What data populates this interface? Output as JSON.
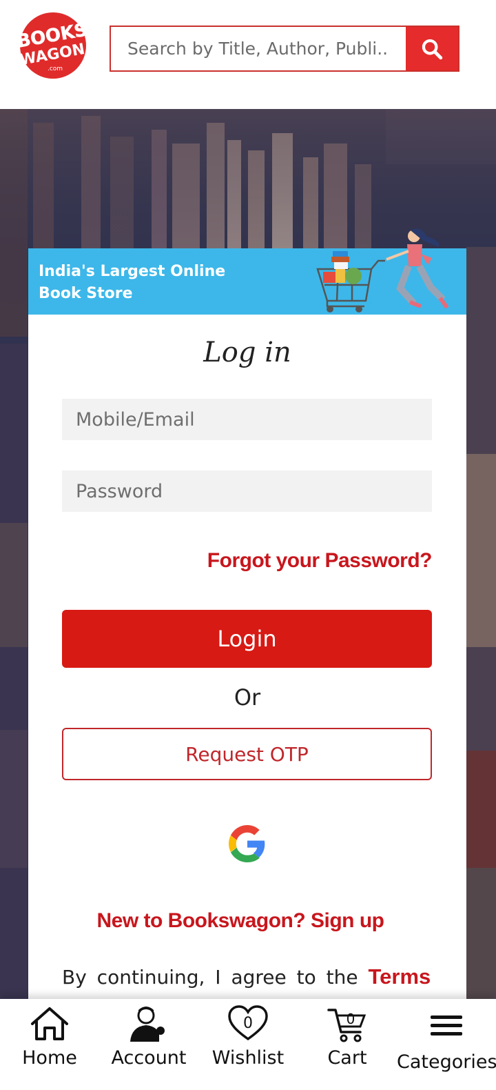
{
  "header": {
    "logo_text": "BOOKSWAGON",
    "logo_sub": ".com",
    "search_placeholder": "Search by Title, Author, Publi..."
  },
  "banner": {
    "line1": "India's Largest Online",
    "line2": "Book Store"
  },
  "login": {
    "title": "Log in",
    "email_placeholder": "Mobile/Email",
    "password_placeholder": "Password",
    "forgot": "Forgot your Password?",
    "login_button": "Login",
    "or": "Or",
    "otp_button": "Request OTP",
    "signup": "New to Bookswagon? Sign up",
    "terms_prefix": "By continuing, I agree to the",
    "terms_link": "Terms"
  },
  "bottom_nav": {
    "home": "Home",
    "account": "Account",
    "wishlist": "Wishlist",
    "wishlist_count": "0",
    "cart": "Cart",
    "cart_count": "0",
    "categories": "Categories"
  },
  "colors": {
    "brand_red": "#d71a14",
    "banner_blue": "#3db7e9"
  }
}
